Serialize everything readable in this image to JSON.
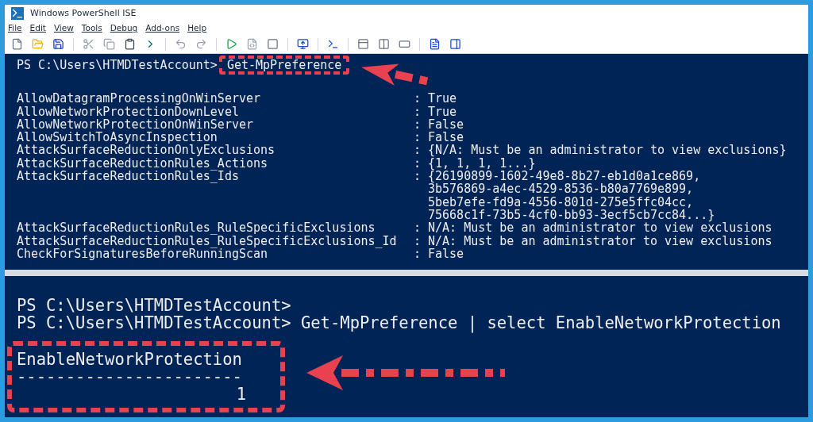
{
  "window": {
    "title": "Windows PowerShell ISE"
  },
  "menu": [
    "File",
    "Edit",
    "View",
    "Tools",
    "Debug",
    "Add-ons",
    "Help"
  ],
  "script_pane": {
    "prompt": "PS C:\\Users\\HTMDTestAccount>",
    "command": "Get-MpPreference",
    "properties": [
      {
        "name": "AllowDatagramProcessingOnWinServer",
        "separator": ":",
        "value": [
          "True"
        ]
      },
      {
        "name": "AllowNetworkProtectionDownLevel",
        "separator": ":",
        "value": [
          "True"
        ]
      },
      {
        "name": "AllowNetworkProtectionOnWinServer",
        "separator": ":",
        "value": [
          "False"
        ]
      },
      {
        "name": "AllowSwitchToAsyncInspection",
        "separator": ":",
        "value": [
          "False"
        ]
      },
      {
        "name": "AttackSurfaceReductionOnlyExclusions",
        "separator": ":",
        "value": [
          "{N/A: Must be an administrator to view exclusions}"
        ]
      },
      {
        "name": "AttackSurfaceReductionRules_Actions",
        "separator": ":",
        "value": [
          "{1, 1, 1, 1...}"
        ]
      },
      {
        "name": "AttackSurfaceReductionRules_Ids",
        "separator": ":",
        "value": [
          "{26190899-1602-49e8-8b27-eb1d0a1ce869,",
          "3b576869-a4ec-4529-8536-b80a7769e899,",
          "5beb7efe-fd9a-4556-801d-275e5ffc04cc,",
          "75668c1f-73b5-4cf0-bb93-3ecf5cb7cc84...}"
        ]
      },
      {
        "name": "AttackSurfaceReductionRules_RuleSpecificExclusions",
        "separator": ":",
        "value": [
          "N/A: Must be an administrator to view exclusions"
        ]
      },
      {
        "name": "AttackSurfaceReductionRules_RuleSpecificExclusions_Id",
        "separator": ":",
        "value": [
          "N/A: Must be an administrator to view exclusions"
        ]
      },
      {
        "name": "CheckForSignaturesBeforeRunningScan",
        "separator": ":",
        "value": [
          "False"
        ]
      }
    ]
  },
  "console_pane": {
    "lines": [
      "PS C:\\Users\\HTMDTestAccount>",
      "PS C:\\Users\\HTMDTestAccount> Get-MpPreference | select EnableNetworkProtection"
    ],
    "output": {
      "header": "EnableNetworkProtection",
      "rule": "-----------------------",
      "value": "1"
    }
  }
}
